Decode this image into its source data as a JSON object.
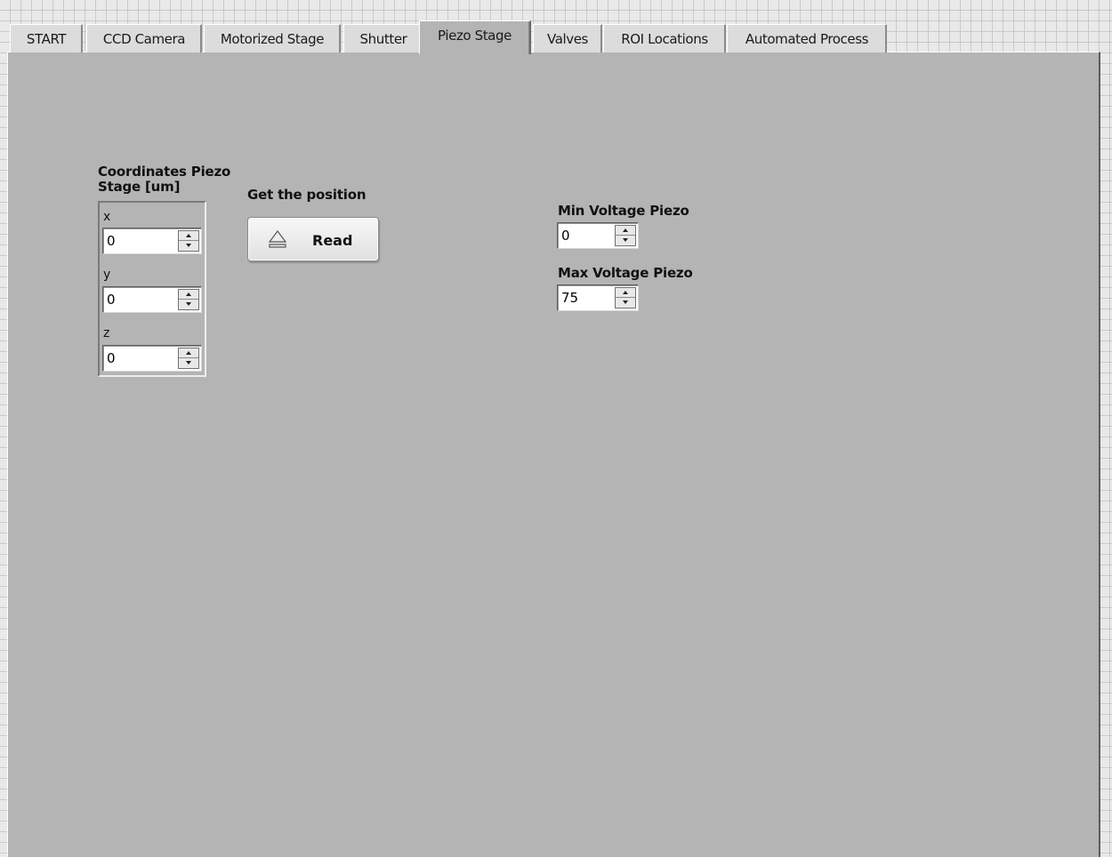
{
  "tabs": {
    "items": [
      {
        "label": "START"
      },
      {
        "label": "CCD Camera"
      },
      {
        "label": "Motorized Stage"
      },
      {
        "label": "Shutter"
      },
      {
        "label": "Piezo Stage"
      },
      {
        "label": "Valves"
      },
      {
        "label": "ROI Locations"
      },
      {
        "label": "Automated Process"
      }
    ],
    "active": "Piezo Stage"
  },
  "coordinates": {
    "title_line1": "Coordinates Piezo",
    "title_line2": "Stage [um]",
    "x": {
      "label": "x",
      "value": "0"
    },
    "y": {
      "label": "y",
      "value": "0"
    },
    "z": {
      "label": "z",
      "value": "0"
    }
  },
  "get_position": {
    "label": "Get the position",
    "button_label": "Read"
  },
  "voltage": {
    "min_label": "Min Voltage Piezo",
    "min_value": "0",
    "max_label": "Max Voltage Piezo",
    "max_value": "75"
  },
  "colors": {
    "panel": "#b4b4b4",
    "tab_inactive": "#dcdcdc",
    "grid_background": "#e9e9e9"
  }
}
